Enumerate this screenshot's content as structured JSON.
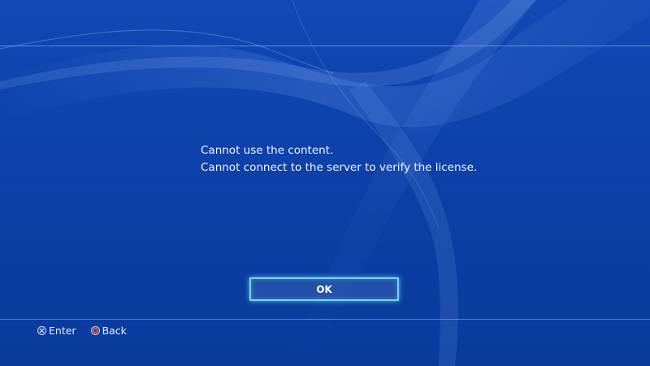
{
  "dialog": {
    "message_line1": "Cannot use the content.",
    "message_line2": "Cannot connect to the server to verify the license.",
    "ok_label": "OK"
  },
  "footer": {
    "enter_label": "Enter",
    "back_label": "Back",
    "enter_icon": "cross-button-icon",
    "back_icon": "circle-button-icon"
  },
  "colors": {
    "background": "#0f43ad",
    "focus_glow": "#6fd6ff",
    "circle_button": "#f04a3a"
  }
}
